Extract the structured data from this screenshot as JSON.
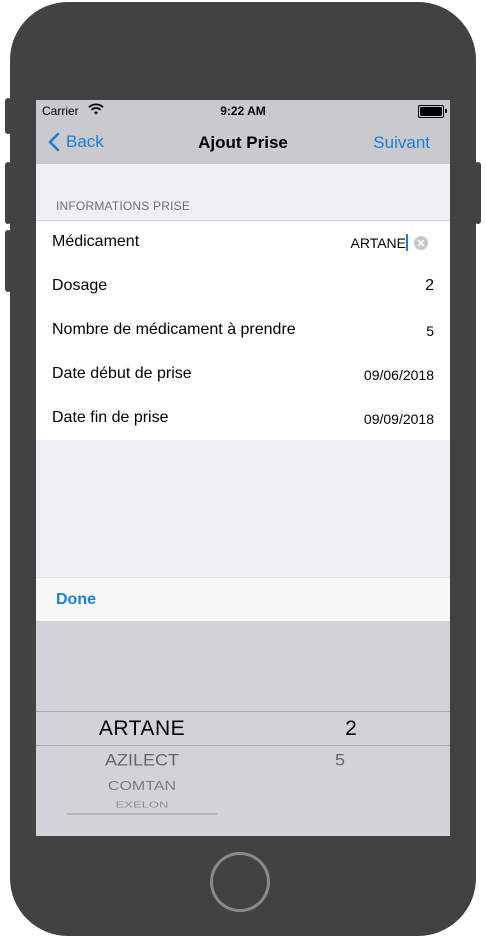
{
  "status_bar": {
    "carrier": "Carrier",
    "time": "9:22 AM"
  },
  "nav": {
    "back_label": "Back",
    "title": "Ajout Prise",
    "next_label": "Suivant"
  },
  "section": {
    "header": "INFORMATIONS PRISE"
  },
  "form": {
    "medicament": {
      "label": "Médicament",
      "value": "ARTANE"
    },
    "dosage": {
      "label": "Dosage",
      "value": "2"
    },
    "nombre": {
      "label": "Nombre de médicament à prendre",
      "value": "5"
    },
    "date_debut": {
      "label": "Date début de prise",
      "value": "09/06/2018"
    },
    "date_fin": {
      "label": "Date fin de prise",
      "value": "09/09/2018"
    }
  },
  "toolbar": {
    "done_label": "Done"
  },
  "picker": {
    "medications": [
      "ARTANE",
      "AZILECT",
      "COMTAN",
      "EXELON"
    ],
    "doses": [
      "2",
      "5"
    ]
  }
}
